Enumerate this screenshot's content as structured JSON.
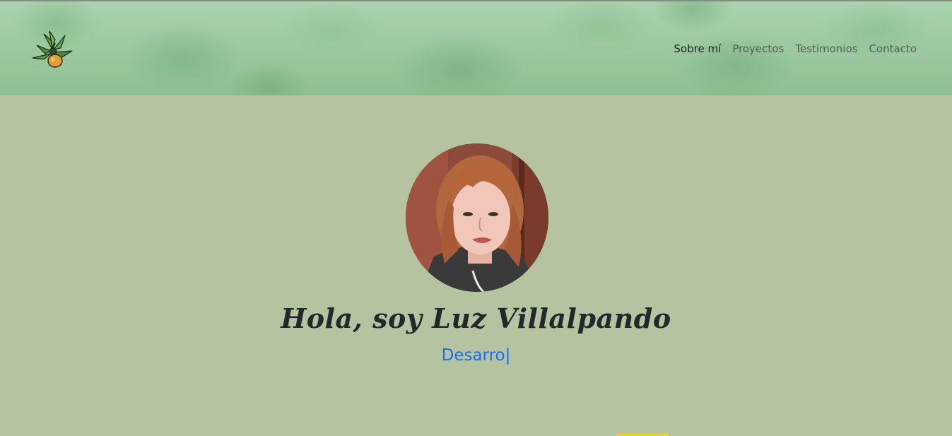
{
  "header": {
    "logo_name": "potted-plant-logo",
    "nav": [
      {
        "label": "Sobre mí",
        "active": true
      },
      {
        "label": "Proyectos",
        "active": false
      },
      {
        "label": "Testimonios",
        "active": false
      },
      {
        "label": "Contacto",
        "active": false
      }
    ]
  },
  "hero": {
    "title": "Hola, soy Luz Villalpando",
    "typed_text": "Desarro",
    "cursor": "|"
  },
  "colors": {
    "page_background": "#b5c4a0",
    "typed_text": "#1a6cf5",
    "title": "#23282a",
    "accent": "#f0d21e"
  }
}
